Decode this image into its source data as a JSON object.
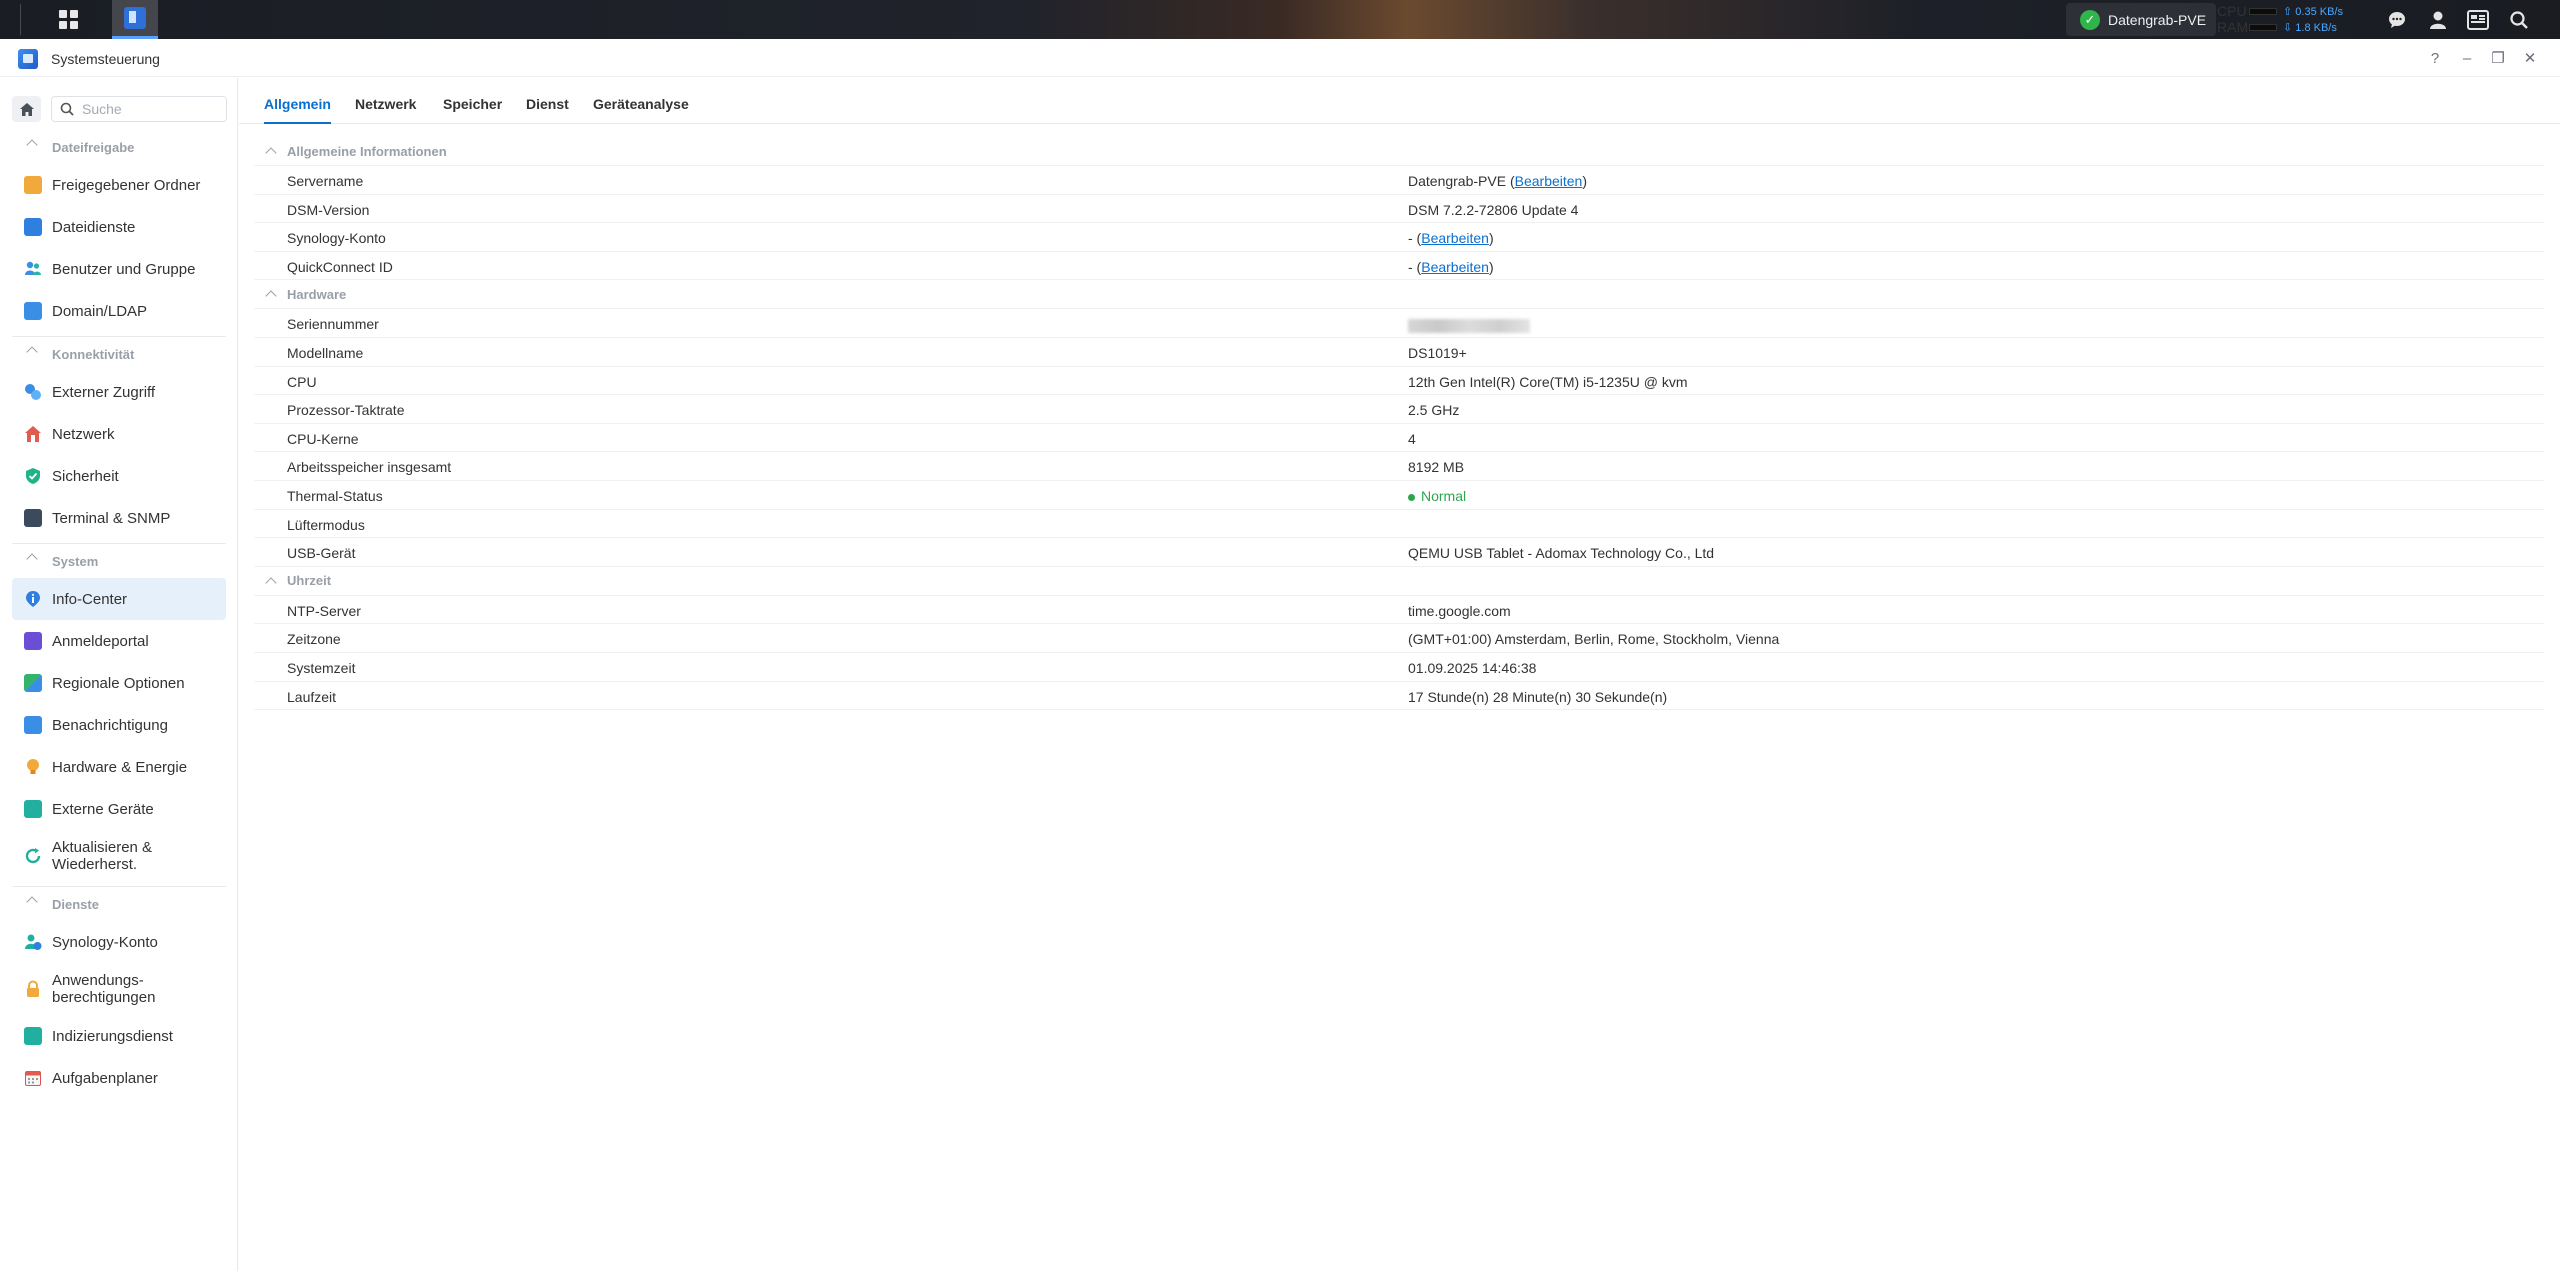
{
  "taskbar": {
    "server_name": "Datengrab-PVE",
    "cpu_label": "CPU",
    "ram_label": "RAM",
    "upload_rate": "0.35 KB/s",
    "download_rate": "1.8 KB/s"
  },
  "window": {
    "title": "Systemsteuerung",
    "help": "?",
    "minimize": "–",
    "restore": "❐",
    "close": "✕"
  },
  "sidebar": {
    "search_placeholder": "Suche",
    "sections": [
      {
        "title": "Dateifreigabe",
        "items": [
          "Freigegebener Ordner",
          "Dateidienste",
          "Benutzer und Gruppe",
          "Domain/LDAP"
        ]
      },
      {
        "title": "Konnektivität",
        "items": [
          "Externer Zugriff",
          "Netzwerk",
          "Sicherheit",
          "Terminal & SNMP"
        ]
      },
      {
        "title": "System",
        "items": [
          "Info-Center",
          "Anmeldeportal",
          "Regionale Optionen",
          "Benachrichtigung",
          "Hardware & Energie",
          "Externe Geräte",
          "Aktualisieren & Wiederherst."
        ]
      },
      {
        "title": "Dienste",
        "items": [
          "Synology-Konto",
          "Anwendungs- berechtigungen",
          "Indizierungsdienst",
          "Aufgabenplaner"
        ]
      }
    ]
  },
  "tabs": [
    "Allgemein",
    "Netzwerk",
    "Speicher",
    "Dienst",
    "Geräteanalyse"
  ],
  "info": {
    "general_title": "Allgemeine Informationen",
    "servername_label": "Servername",
    "servername_value": "Datengrab-PVE",
    "edit_link": "Bearbeiten",
    "dsm_label": "DSM-Version",
    "dsm_value": "DSM 7.2.2-72806 Update 4",
    "account_label": "Synology-Konto",
    "account_value": "-",
    "quickconnect_label": "QuickConnect ID",
    "quickconnect_value": "-",
    "hardware_title": "Hardware",
    "serial_label": "Seriennummer",
    "model_label": "Modellname",
    "model_value": "DS1019+",
    "cpu_label": "CPU",
    "cpu_value": "12th Gen Intel(R) Core(TM) i5-1235U @ kvm",
    "clock_label": "Prozessor-Taktrate",
    "clock_value": "2.5 GHz",
    "cores_label": "CPU-Kerne",
    "cores_value": "4",
    "memory_label": "Arbeitsspeicher insgesamt",
    "memory_value": "8192 MB",
    "thermal_label": "Thermal-Status",
    "thermal_value": "Normal",
    "fan_label": "Lüftermodus",
    "fan_value": "",
    "usb_label": "USB-Gerät",
    "usb_value": "QEMU USB Tablet - Adomax Technology Co., Ltd",
    "time_title": "Uhrzeit",
    "ntp_label": "NTP-Server",
    "ntp_value": "time.google.com",
    "tz_label": "Zeitzone",
    "tz_value": "(GMT+01:00) Amsterdam, Berlin, Rome, Stockholm, Vienna",
    "systime_label": "Systemzeit",
    "systime_value": "01.09.2025 14:46:38",
    "uptime_label": "Laufzeit",
    "uptime_value": "17 Stunde(n) 28 Minute(n) 30 Sekunde(n)"
  }
}
